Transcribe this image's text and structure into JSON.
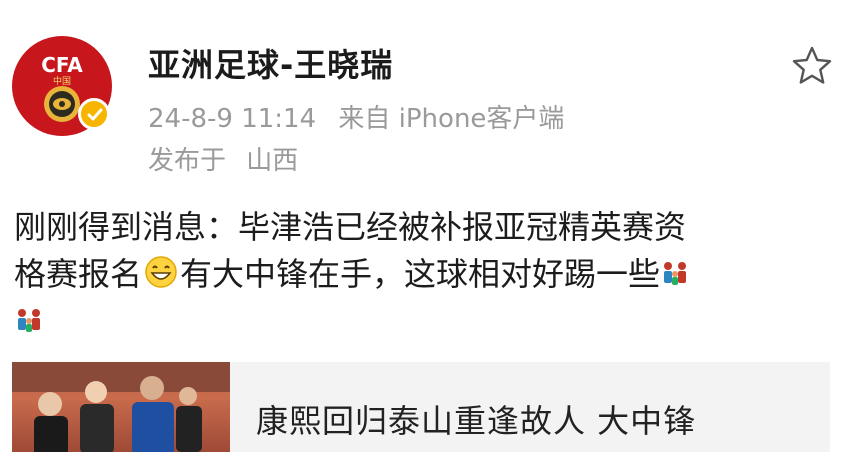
{
  "post": {
    "author": "亚洲足球-王晓瑞",
    "timestamp": "24-8-9 11:14",
    "source": "来自 iPhone客户端",
    "location_prefix": "发布于",
    "location": "山西",
    "text_line1": "刚刚得到消息：毕津浩已经被补报亚冠精英赛资",
    "text_line2_a": "格赛报名",
    "text_line2_b": "有大中锋在手，这球相对好踢一些",
    "avatar_logo_text": "CFA",
    "avatar_logo_subtext": "中国"
  },
  "card": {
    "title": "康熙回归泰山重逢故人 大中锋"
  },
  "icons": {
    "favorite": "star-outline-icon",
    "verified": "verified-badge-icon",
    "smile": "grin-emoji-icon",
    "people": "family-emoji-icon"
  },
  "colors": {
    "avatar_bg": "#c8161d",
    "verified": "#f7b500",
    "meta_text": "#9a9a9a",
    "card_bg": "#f3f3f3"
  }
}
